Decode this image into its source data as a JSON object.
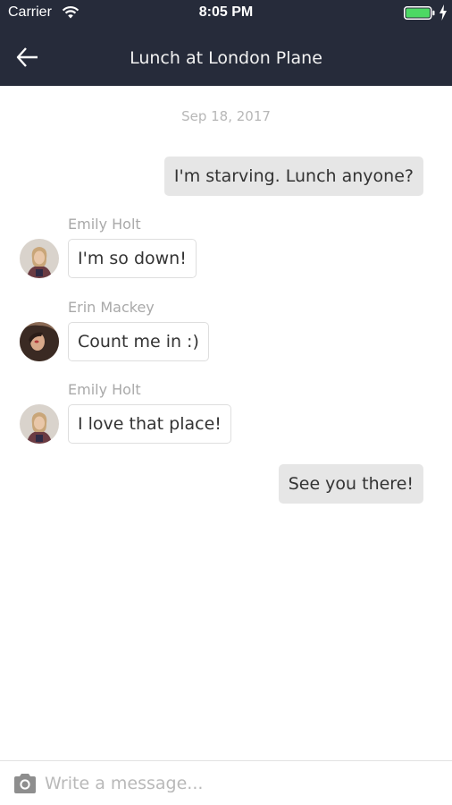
{
  "status": {
    "carrier": "Carrier",
    "time": "8:05 PM"
  },
  "header": {
    "title": "Lunch at London Plane"
  },
  "conversation": {
    "date": "Sep 18, 2017",
    "messages": [
      {
        "direction": "out",
        "text": "I'm starving. Lunch anyone?"
      },
      {
        "direction": "in",
        "sender": "Emily Holt",
        "text": "I'm so down!"
      },
      {
        "direction": "in",
        "sender": "Erin Mackey",
        "text": "Count me in :)"
      },
      {
        "direction": "in",
        "sender": "Emily Holt",
        "text": "I love that place!"
      },
      {
        "direction": "out",
        "text": "See you there!"
      }
    ]
  },
  "composer": {
    "placeholder": "Write a message..."
  },
  "icons": {
    "wifi": "wifi-icon",
    "battery": "battery-icon",
    "charging": "bolt-icon",
    "back": "back-arrow-icon",
    "camera": "camera-icon"
  },
  "colors": {
    "header_bg": "#262b3a",
    "outgoing_bubble": "#e6e6e6",
    "incoming_bubble_border": "#dedede",
    "battery_fill": "#4cd964"
  }
}
